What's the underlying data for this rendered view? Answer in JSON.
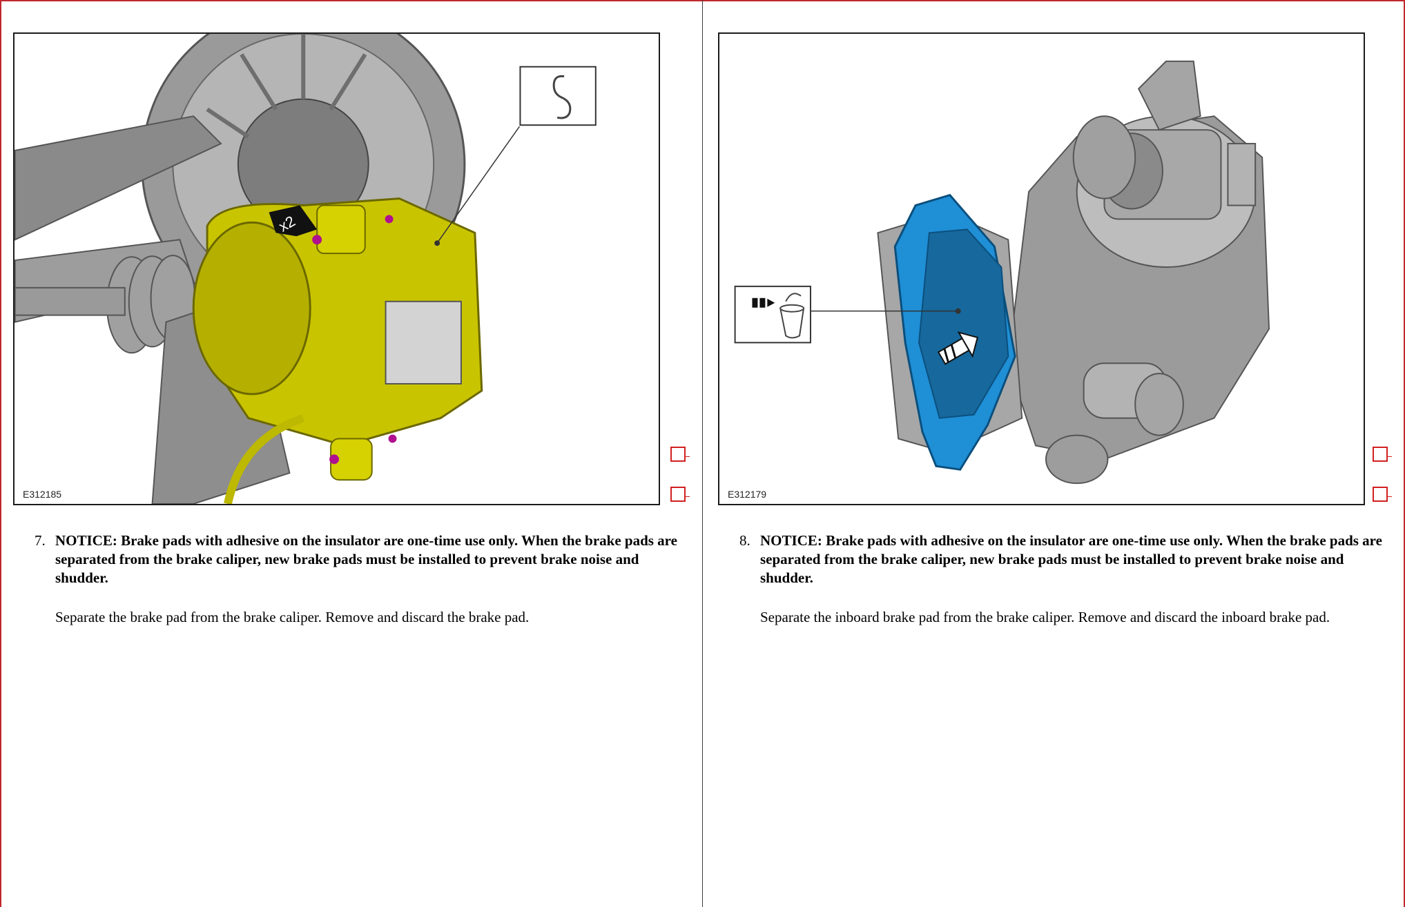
{
  "left": {
    "figure": {
      "code": "E312185",
      "badge": "x2"
    },
    "step": {
      "number": "7.",
      "notice": "NOTICE: Brake pads with adhesive on the insulator are one-time use only. When the brake pads are separated from the brake caliper, new brake pads must be installed to prevent brake noise and shudder.",
      "instruction": "Separate the brake pad from the brake caliper. Remove and discard the brake pad."
    }
  },
  "right": {
    "figure": {
      "code": "E312179"
    },
    "step": {
      "number": "8.",
      "notice": "NOTICE: Brake pads with adhesive on the insulator are one-time use only. When the brake pads are separated from the brake caliper, new brake pads must be installed to prevent brake noise and shudder.",
      "instruction": "Separate the inboard brake pad from the brake caliper. Remove and discard the inboard brake pad."
    }
  },
  "colors": {
    "page_border": "#c0282d",
    "checkbox": "#d11f1f",
    "caliper_yellow": "#c9c400",
    "pad_blue": "#1f8fd6",
    "steel_gray": "#8c8c8c"
  },
  "icons": [
    "s-hook-icon",
    "discard-bin-icon",
    "repeat-x2-arrow-icon",
    "direction-arrow-icon"
  ]
}
